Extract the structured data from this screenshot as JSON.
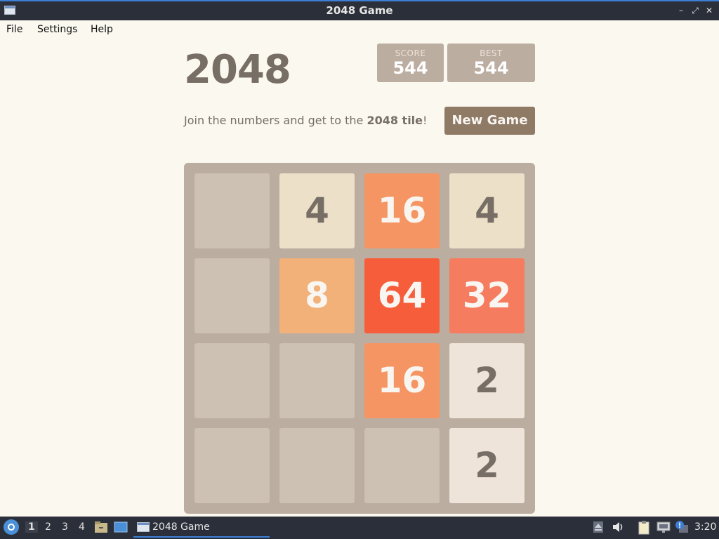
{
  "window": {
    "title": "2048 Game"
  },
  "menu": [
    "File",
    "Settings",
    "Help"
  ],
  "game": {
    "title": "2048",
    "score_label": "SCORE",
    "score": "544",
    "best_label": "BEST",
    "best": "544",
    "intro_prefix": "Join the numbers and get to the ",
    "intro_bold": "2048 tile",
    "intro_suffix": "!",
    "new_game_label": "New Game",
    "board": [
      [
        null,
        4,
        16,
        4
      ],
      [
        null,
        8,
        64,
        32
      ],
      [
        null,
        null,
        16,
        2
      ],
      [
        null,
        null,
        null,
        2
      ]
    ],
    "tile_colors": {
      "2": {
        "bg": "#eee4da",
        "fg": "#776e65"
      },
      "4": {
        "bg": "#ede0c8",
        "fg": "#776e65"
      },
      "8": {
        "bg": "#f2b179",
        "fg": "#f9f6f2"
      },
      "16": {
        "bg": "#f59563",
        "fg": "#f9f6f2"
      },
      "32": {
        "bg": "#f67c5f",
        "fg": "#f9f6f2"
      },
      "64": {
        "bg": "#f65e3b",
        "fg": "#f9f6f2"
      }
    }
  },
  "taskbar": {
    "workspaces": [
      "1",
      "2",
      "3",
      "4"
    ],
    "active_workspace": "1",
    "task_label": "2048 Game",
    "clock": "3:20"
  }
}
